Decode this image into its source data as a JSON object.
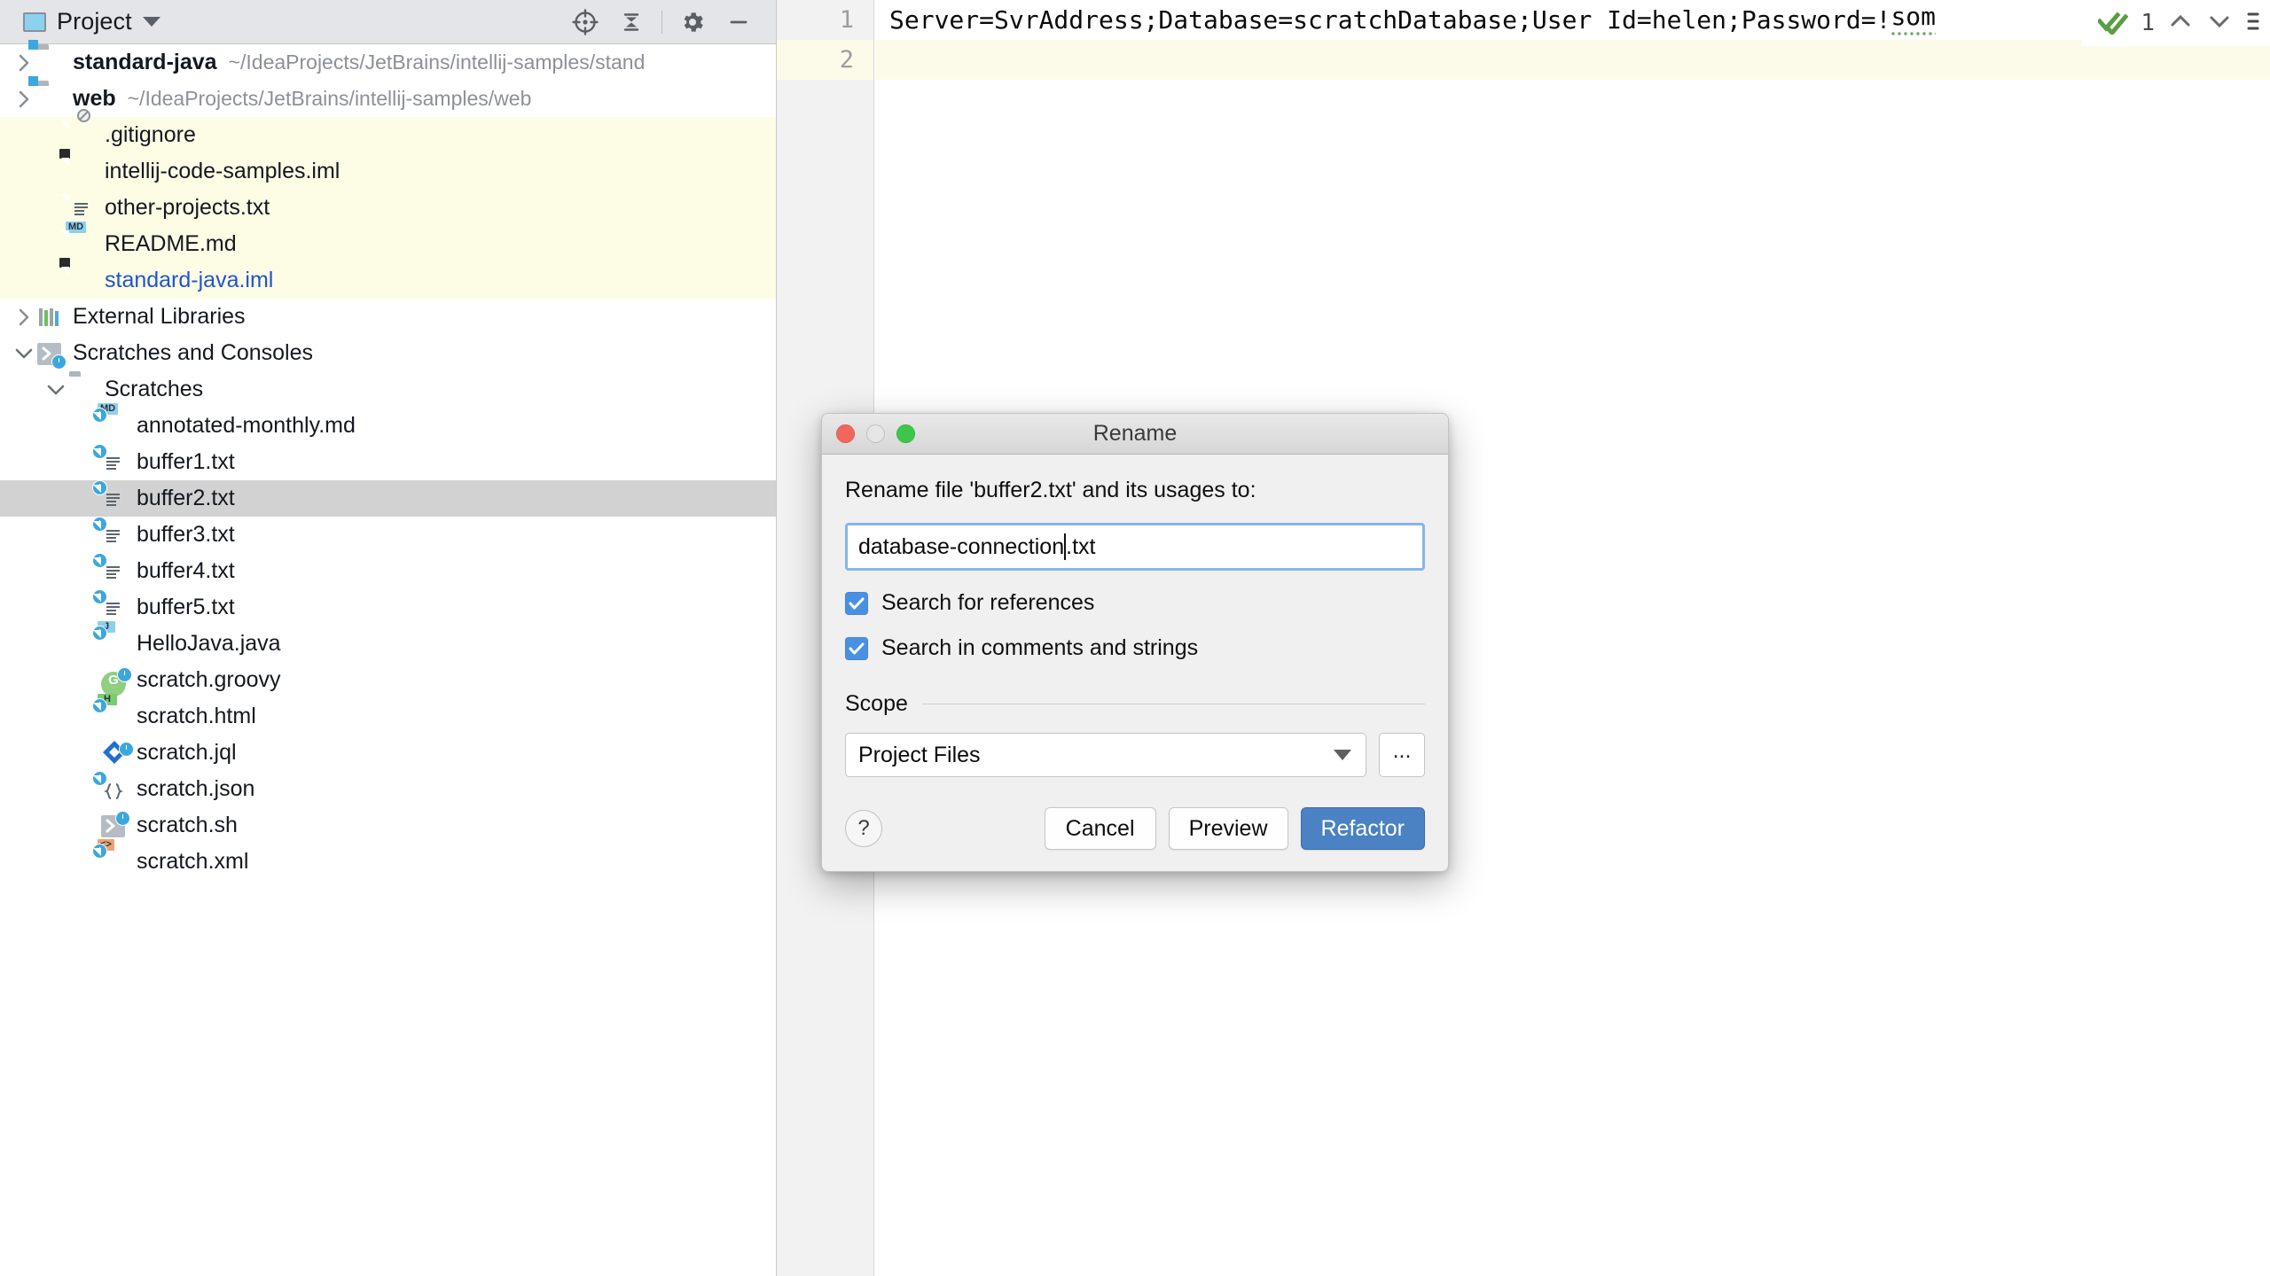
{
  "panel": {
    "title": "Project",
    "toolbar_icons": [
      "locate-target-icon",
      "collapse-all-icon",
      "settings-gear-icon",
      "minimize-icon"
    ],
    "tree": [
      {
        "indent": 0,
        "arrow": "right",
        "icon": "module-folder-icon",
        "label": "standard-java",
        "bold": true,
        "path": "~/IdeaProjects/JetBrains/intellij-samples/stand",
        "style": "plain"
      },
      {
        "indent": 0,
        "arrow": "right",
        "icon": "module-folder-icon",
        "label": "web",
        "bold": true,
        "path": "~/IdeaProjects/JetBrains/intellij-samples/web",
        "style": "plain"
      },
      {
        "indent": 1,
        "arrow": "none",
        "icon": "gitignore-file-icon",
        "label": ".gitignore",
        "path": "",
        "style": "yellow"
      },
      {
        "indent": 1,
        "arrow": "none",
        "icon": "iml-file-icon",
        "label": "intellij-code-samples.iml",
        "path": "",
        "style": "yellow"
      },
      {
        "indent": 1,
        "arrow": "none",
        "icon": "text-file-icon",
        "label": "other-projects.txt",
        "path": "",
        "style": "yellow"
      },
      {
        "indent": 1,
        "arrow": "none",
        "icon": "markdown-file-icon",
        "label": "README.md",
        "path": "",
        "style": "yellow"
      },
      {
        "indent": 1,
        "arrow": "none",
        "icon": "iml-file-icon",
        "label": "standard-java.iml",
        "path": "",
        "style": "yellow",
        "blue": true
      },
      {
        "indent": 0,
        "arrow": "right",
        "icon": "external-libraries-icon",
        "label": "External Libraries",
        "path": "",
        "style": "plain"
      },
      {
        "indent": 0,
        "arrow": "down",
        "icon": "scratches-consoles-icon",
        "label": "Scratches and Consoles",
        "path": "",
        "style": "plain"
      },
      {
        "indent": 1,
        "arrow": "down",
        "icon": "folder-icon",
        "label": "Scratches",
        "path": "",
        "style": "plain"
      },
      {
        "indent": 2,
        "arrow": "none",
        "icon": "scratch-markdown-icon",
        "label": "annotated-monthly.md",
        "path": "",
        "style": "plain"
      },
      {
        "indent": 2,
        "arrow": "none",
        "icon": "scratch-text-icon",
        "label": "buffer1.txt",
        "path": "",
        "style": "plain"
      },
      {
        "indent": 2,
        "arrow": "none",
        "icon": "scratch-text-icon",
        "label": "buffer2.txt",
        "path": "",
        "style": "selected"
      },
      {
        "indent": 2,
        "arrow": "none",
        "icon": "scratch-text-icon",
        "label": "buffer3.txt",
        "path": "",
        "style": "plain"
      },
      {
        "indent": 2,
        "arrow": "none",
        "icon": "scratch-text-icon",
        "label": "buffer4.txt",
        "path": "",
        "style": "plain"
      },
      {
        "indent": 2,
        "arrow": "none",
        "icon": "scratch-text-icon",
        "label": "buffer5.txt",
        "path": "",
        "style": "plain"
      },
      {
        "indent": 2,
        "arrow": "none",
        "icon": "scratch-java-icon",
        "label": "HelloJava.java",
        "path": "",
        "style": "plain"
      },
      {
        "indent": 2,
        "arrow": "none",
        "icon": "scratch-groovy-icon",
        "label": "scratch.groovy",
        "path": "",
        "style": "plain"
      },
      {
        "indent": 2,
        "arrow": "none",
        "icon": "scratch-html-icon",
        "label": "scratch.html",
        "path": "",
        "style": "plain"
      },
      {
        "indent": 2,
        "arrow": "none",
        "icon": "scratch-jql-icon",
        "label": "scratch.jql",
        "path": "",
        "style": "plain"
      },
      {
        "indent": 2,
        "arrow": "none",
        "icon": "scratch-json-icon",
        "label": "scratch.json",
        "path": "",
        "style": "plain"
      },
      {
        "indent": 2,
        "arrow": "none",
        "icon": "scratch-shell-icon",
        "label": "scratch.sh",
        "path": "",
        "style": "plain"
      },
      {
        "indent": 2,
        "arrow": "none",
        "icon": "scratch-xml-icon",
        "label": "scratch.xml",
        "path": "",
        "style": "plain"
      }
    ]
  },
  "editor": {
    "line_numbers": [
      "1",
      "2"
    ],
    "line1_main": "Server=SvrAddress;Database=scratchDatabase;User Id=helen;Password=!",
    "line1_warn": "som",
    "line2": "",
    "inspection_count": "1",
    "inspection_state": "ok-green-check"
  },
  "dialog": {
    "title": "Rename",
    "prompt": "Rename file 'buffer2.txt' and its usages to:",
    "input_value_before_caret": "database-connection",
    "input_value_after_caret": ".txt",
    "checkbox_references_label": "Search for references",
    "checkbox_references_checked": true,
    "checkbox_comments_label": "Search in comments and strings",
    "checkbox_comments_checked": true,
    "scope_section_label": "Scope",
    "scope_value": "Project Files",
    "scope_more_label": "...",
    "help_label": "?",
    "cancel_label": "Cancel",
    "preview_label": "Preview",
    "refactor_label": "Refactor",
    "accent_color": "#4a82c4",
    "checkbox_color": "#4a90e2"
  }
}
